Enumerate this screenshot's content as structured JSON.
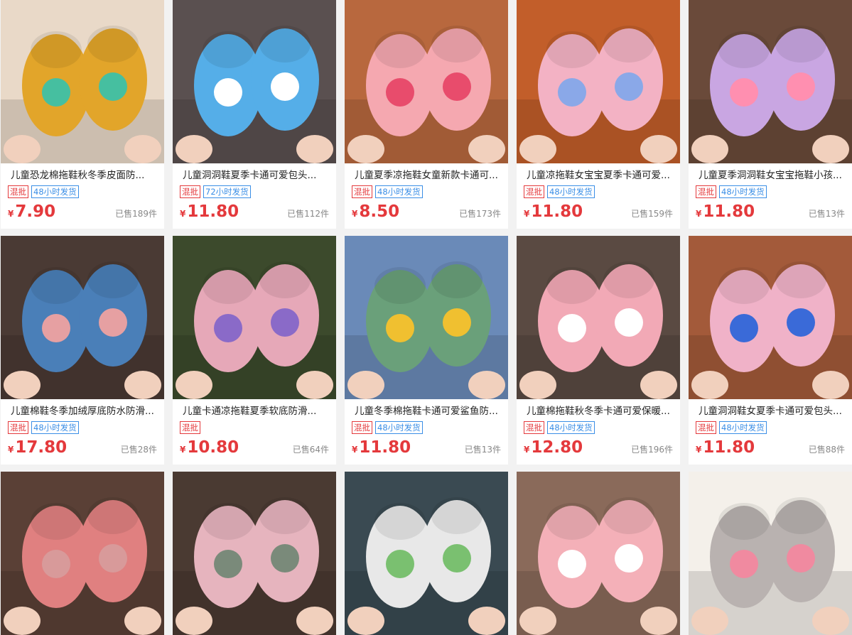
{
  "currency": "¥",
  "products": [
    {
      "title": "儿童恐龙棉拖鞋秋冬季皮面防...",
      "tags": [
        "混批",
        "48小时发货"
      ],
      "price": "7.90",
      "sold": "已售189件",
      "bg": "#e9d9c8",
      "shoe": "#e2a52a",
      "accent": "#46bfa0"
    },
    {
      "title": "儿童洞洞鞋夏季卡通可爱包头...",
      "tags": [
        "混批",
        "72小时发货"
      ],
      "price": "11.80",
      "sold": "已售112件",
      "bg": "#5a5050",
      "shoe": "#55aee8",
      "accent": "#ffffff"
    },
    {
      "title": "儿童夏季凉拖鞋女童新款卡通可...",
      "tags": [
        "混批",
        "48小时发货"
      ],
      "price": "8.50",
      "sold": "已售173件",
      "bg": "#b8683e",
      "shoe": "#f5a8b0",
      "accent": "#e84c6c"
    },
    {
      "title": "儿童凉拖鞋女宝宝夏季卡通可爱...",
      "tags": [
        "混批",
        "48小时发货"
      ],
      "price": "11.80",
      "sold": "已售159件",
      "bg": "#c25e2a",
      "shoe": "#f3b2c4",
      "accent": "#8aa8e8"
    },
    {
      "title": "儿童夏季洞洞鞋女宝宝拖鞋小孩...",
      "tags": [
        "混批",
        "48小时发货"
      ],
      "price": "11.80",
      "sold": "已售13件",
      "bg": "#6a4a3a",
      "shoe": "#c9a6e2",
      "accent": "#ff8fb0"
    },
    {
      "title": "儿童棉鞋冬季加绒厚底防水防滑...",
      "tags": [
        "混批",
        "48小时发货"
      ],
      "price": "17.80",
      "sold": "已售28件",
      "bg": "#4a3a34",
      "shoe": "#4a7fb8",
      "accent": "#e6a0a2"
    },
    {
      "title": "儿童卡通凉拖鞋夏季软底防滑...",
      "tags": [
        "混批"
      ],
      "price": "10.80",
      "sold": "已售64件",
      "bg": "#3c4a2c",
      "shoe": "#e6a8b8",
      "accent": "#8a6ac8"
    },
    {
      "title": "儿童冬季棉拖鞋卡通可爱鲨鱼防...",
      "tags": [
        "混批",
        "48小时发货"
      ],
      "price": "11.80",
      "sold": "已售13件",
      "bg": "#6a8ab8",
      "shoe": "#6aa07a",
      "accent": "#f0c030"
    },
    {
      "title": "儿童棉拖鞋秋冬季卡通可爱保暖...",
      "tags": [
        "混批",
        "48小时发货"
      ],
      "price": "12.80",
      "sold": "已售196件",
      "bg": "#5a4a42",
      "shoe": "#f2a9b6",
      "accent": "#ffffff"
    },
    {
      "title": "儿童洞洞鞋女夏季卡通可爱包头...",
      "tags": [
        "混批",
        "48小时发货"
      ],
      "price": "11.80",
      "sold": "已售88件",
      "bg": "#a35a3a",
      "shoe": "#f0b2c8",
      "accent": "#3a6ad8"
    },
    {
      "bg": "#5a4036",
      "shoe": "#e08080",
      "accent": "#d89a9a"
    },
    {
      "bg": "#4a3a32",
      "shoe": "#e6b4be",
      "accent": "#7a8a7a"
    },
    {
      "bg": "#3a4a52",
      "shoe": "#e8e8e8",
      "accent": "#7ac070"
    },
    {
      "bg": "#8a6a5a",
      "shoe": "#f4b0b8",
      "accent": "#ffffff"
    },
    {
      "bg": "#f4f0ea",
      "shoe": "#b9b2b0",
      "accent": "#f08aa0"
    }
  ]
}
